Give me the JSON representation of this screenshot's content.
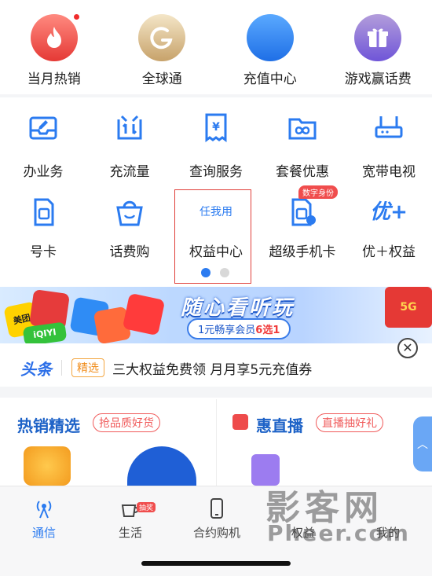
{
  "top_row": [
    {
      "label": "当月热销",
      "icon": "fire-icon"
    },
    {
      "label": "全球通",
      "icon": "global-logo-icon"
    },
    {
      "label": "充值中心",
      "icon": "recharge-icon"
    },
    {
      "label": "游戏赢话费",
      "icon": "gift-icon"
    }
  ],
  "grid_row1": [
    {
      "label": "办业务",
      "icon": "inbox-pen-icon"
    },
    {
      "label": "充流量",
      "icon": "data-traffic-icon"
    },
    {
      "label": "查询服务",
      "icon": "receipt-yen-icon"
    },
    {
      "label": "套餐优惠",
      "icon": "folder-infinity-icon"
    },
    {
      "label": "宽带电视",
      "icon": "router-icon"
    }
  ],
  "grid_row2": [
    {
      "label": "号卡",
      "icon": "sim-card-icon"
    },
    {
      "label": "话费购",
      "icon": "shopping-basket-icon"
    },
    {
      "label": "权益中心",
      "icon_text": "任我用"
    },
    {
      "label": "超级手机卡",
      "icon": "super-sim-icon",
      "badge": "数字身份"
    },
    {
      "label": "优＋权益",
      "icon_text": "优+"
    }
  ],
  "banner": {
    "title": "随心看听玩",
    "sub_prefix": "1元畅享会员",
    "sub_highlight": "6选1",
    "tile_texts": [
      "美团",
      "iQIYI",
      "5G"
    ]
  },
  "ticker": {
    "logo": "头条",
    "tag": "精选",
    "text": "三大权益免费领  月月享5元充值券"
  },
  "cards": {
    "left_title": "热销精选",
    "left_tag": "抢品质好货",
    "right_title": "惠直播",
    "right_tag": "直播抽好礼"
  },
  "tabbar": [
    {
      "label": "通信",
      "icon": "signal-tower-icon",
      "active": true
    },
    {
      "label": "生活",
      "icon": "coffee-cup-icon",
      "badge": "抽奖"
    },
    {
      "label": "合约购机",
      "icon": "phone-icon"
    },
    {
      "label": "权益",
      "icon": "gift-icon"
    },
    {
      "label": "我的",
      "icon": "user-icon"
    }
  ],
  "watermark": {
    "line1": "影客网",
    "line2": "Pheer.com"
  },
  "colors": {
    "primary": "#2b7bf0",
    "accent_red": "#e0403a",
    "title_blue": "#1d62c7"
  }
}
